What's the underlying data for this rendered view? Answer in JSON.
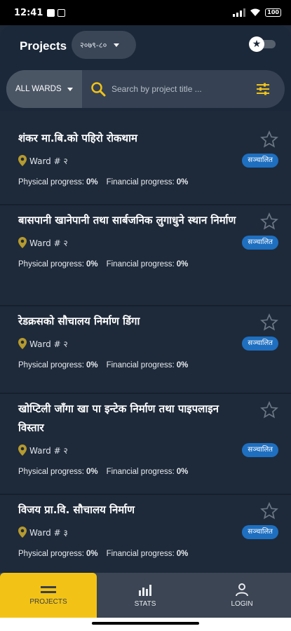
{
  "status_bar": {
    "time": "12:41",
    "battery": "100"
  },
  "header": {
    "title": "Projects",
    "fiscal_year": "२०७९-८०",
    "favorites_toggle_icon": "star-icon"
  },
  "search": {
    "ward_filter": "ALL WARDS",
    "placeholder": "Search by project title ..."
  },
  "progress_labels": {
    "physical": "Physical progress:",
    "financial": "Financial progress:"
  },
  "projects": [
    {
      "title": "शंकर मा.बि.को पहिरो रोकथाम",
      "ward": "Ward # २",
      "status": "सञ्चालित",
      "physical": "0%",
      "financial": "0%"
    },
    {
      "title": "बासपानी खानेपानी तथा सार्बजनिक लुगाधुने स्थान निर्माण",
      "ward": "Ward # २",
      "status": "सञ्चालित",
      "physical": "0%",
      "financial": "0%"
    },
    {
      "title": "रेडक्रसको सौचालय निर्माण डिंगा",
      "ward": "Ward # २",
      "status": "सञ्चालित",
      "physical": "0%",
      "financial": "0%"
    },
    {
      "title": "खोप्टिली जाँगा खा पा इन्टेक निर्माण तथा पाइपलाइन विस्तार",
      "ward": "Ward # २",
      "status": "सञ्चालित",
      "physical": "0%",
      "financial": "0%"
    },
    {
      "title": "विजय प्रा.वि. सौचालय निर्माण",
      "ward": "Ward # ३",
      "status": "सञ्चालित",
      "physical": "0%",
      "financial": "0%"
    }
  ],
  "bottom_nav": {
    "projects": "PROJECTS",
    "stats": "STATS",
    "login": "LOGIN"
  },
  "colors": {
    "background": "#1e2a3a",
    "accent": "#f2c316",
    "badge": "#1e6fc0",
    "pin": "#b59a2e"
  }
}
